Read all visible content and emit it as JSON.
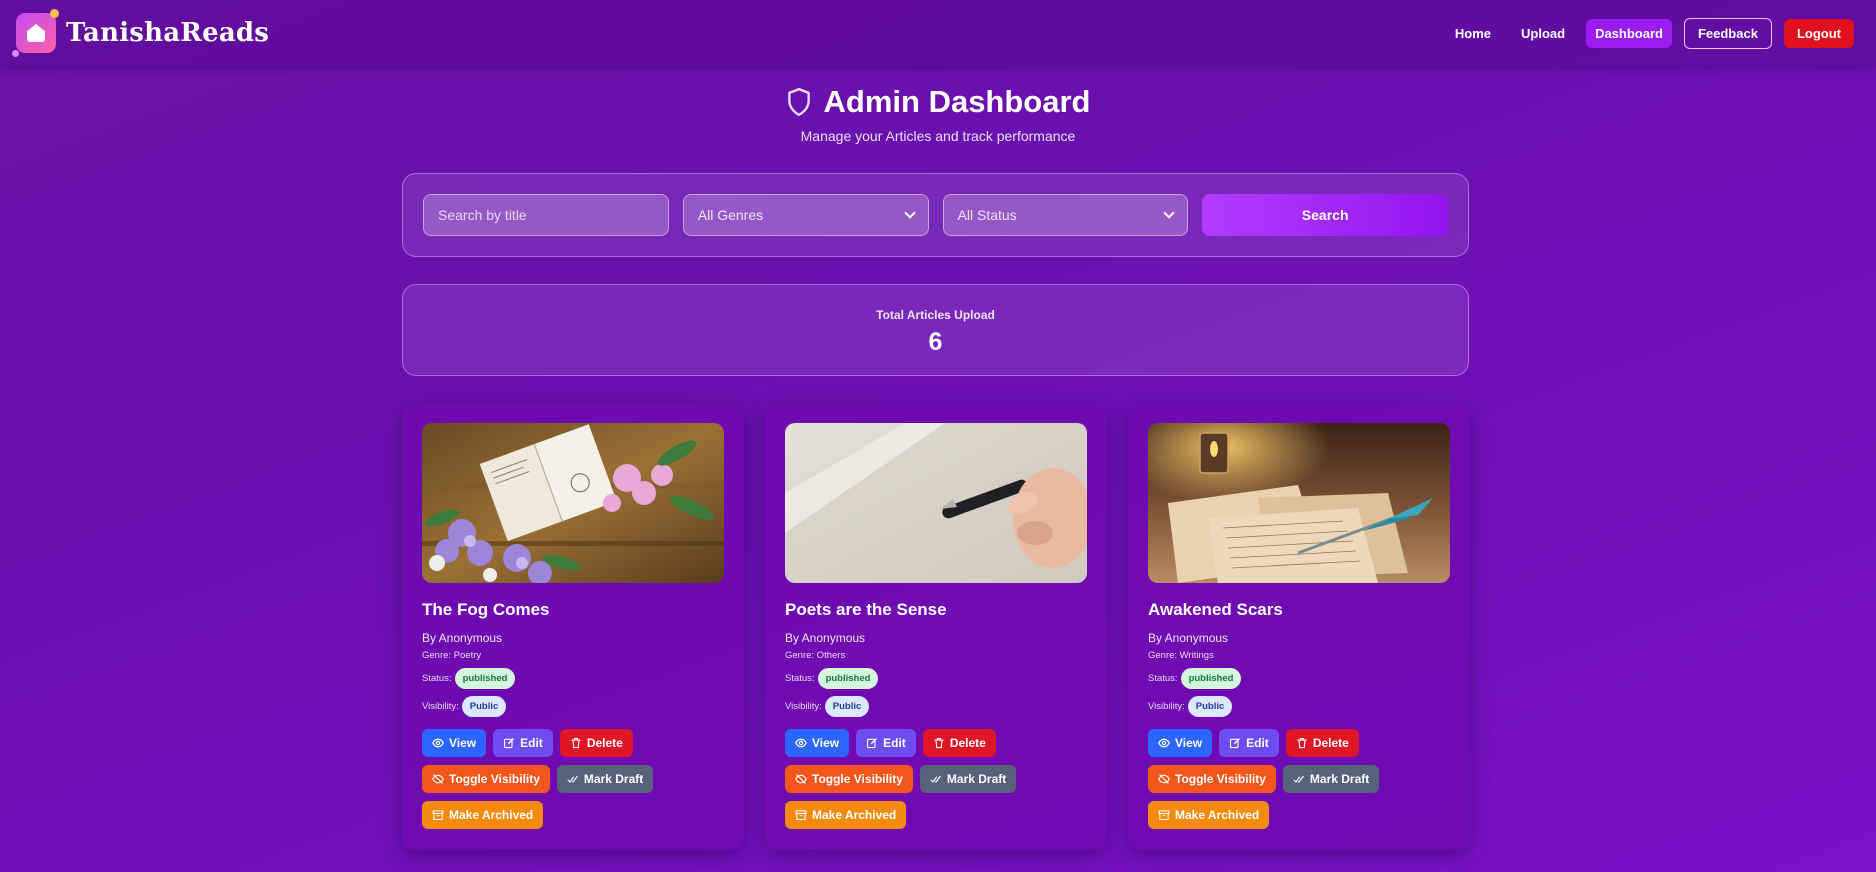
{
  "navbar": {
    "brand": "TanishaReads",
    "links": [
      {
        "label": "Home"
      },
      {
        "label": "Upload"
      },
      {
        "label": "Dashboard"
      },
      {
        "label": "Feedback"
      },
      {
        "label": "Logout"
      }
    ]
  },
  "header": {
    "title": "Admin Dashboard",
    "subtitle": "Manage your Articles and track performance"
  },
  "filters": {
    "search_placeholder": "Search by title",
    "genre_selected": "All Genres",
    "status_selected": "All Status",
    "search_label": "Search"
  },
  "stats": {
    "label": "Total Articles Upload",
    "value": "6"
  },
  "labels": {
    "genre_prefix": "Genre: ",
    "status": "Status:",
    "visibility": "Visibility:",
    "view": "View",
    "edit": "Edit",
    "delete": "Delete",
    "toggle": "Toggle Visibility",
    "draft": "Mark Draft",
    "archive": "Make Archived"
  },
  "articles": [
    {
      "title": "The Fog Comes",
      "author": "By Anonymous",
      "genre": "Genre: Poetry",
      "status": "published",
      "visibility": "Public"
    },
    {
      "title": "Poets are the Sense",
      "author": "By Anonymous",
      "genre": "Genre: Others",
      "status": "published",
      "visibility": "Public"
    },
    {
      "title": "Awakened Scars",
      "author": "By Anonymous",
      "genre": "Genre: Writings",
      "status": "published",
      "visibility": "Public"
    }
  ]
}
